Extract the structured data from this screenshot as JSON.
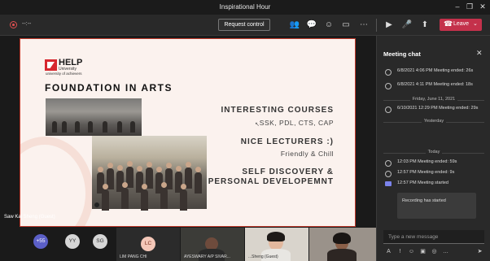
{
  "window": {
    "title": "Inspirational Hour"
  },
  "toolbar": {
    "timer": "--:--",
    "request_control_label": "Request control",
    "leave_label": "Leave",
    "icons": [
      "people-icon",
      "chat-icon",
      "reactions-icon",
      "rooms-icon",
      "more-icon",
      "camera-icon",
      "mic-icon",
      "share-icon",
      "phone-icon"
    ]
  },
  "slide": {
    "logo_text": "HELP",
    "logo_sub": "University",
    "logo_tagline": "university of achievers",
    "title": "FOUNDATION IN ARTS",
    "sections": [
      {
        "heading": "INTERESTING COURSES",
        "sub": "SSK, PDL, CTS, CAP"
      },
      {
        "heading": "NICE LECTURERS :)",
        "sub": "Friendly & Chill"
      },
      {
        "heading": "SELF DISCOVERY &",
        "heading2": "PERSONAL DEVELOPEMNT"
      }
    ]
  },
  "stage": {
    "speaker": "Saw Kai Sheng (Guest)"
  },
  "chat": {
    "title": "Meeting chat",
    "events": [
      {
        "text": "6/8/2021 4:06 PM  Meeting ended: 26s"
      },
      {
        "text": "6/8/2021 4:11 PM  Meeting ended: 18s"
      },
      {
        "divider": "Friday, June 11, 2021"
      },
      {
        "text": "6/10/2021 12:29 PM  Meeting ended: 29s"
      },
      {
        "divider": "Yesterday"
      },
      {
        "divider": "Today"
      },
      {
        "text": "12:03 PM  Meeting ended: 59s"
      },
      {
        "text": "12:57 PM  Meeting ended: 9s"
      },
      {
        "text": "12:57 PM  Meeting started"
      }
    ],
    "recording_card": "Recording has started",
    "compose_placeholder": "Type a new message"
  },
  "participants": {
    "overflow": "+55",
    "initials": [
      "YY",
      "SG",
      "LC"
    ],
    "tiles": [
      {
        "name": "LIM PANG CHI"
      },
      {
        "name": "AYESWARY A/P SIVAR..."
      },
      {
        "name": "...Sheng (Guest)"
      },
      {
        "name": ""
      }
    ]
  },
  "colors": {
    "accent": "#c4314b",
    "chat_bg": "#292929",
    "stage_bg": "#1a1a1a",
    "slide_border": "#c0392b",
    "help_red": "#d7262e"
  }
}
